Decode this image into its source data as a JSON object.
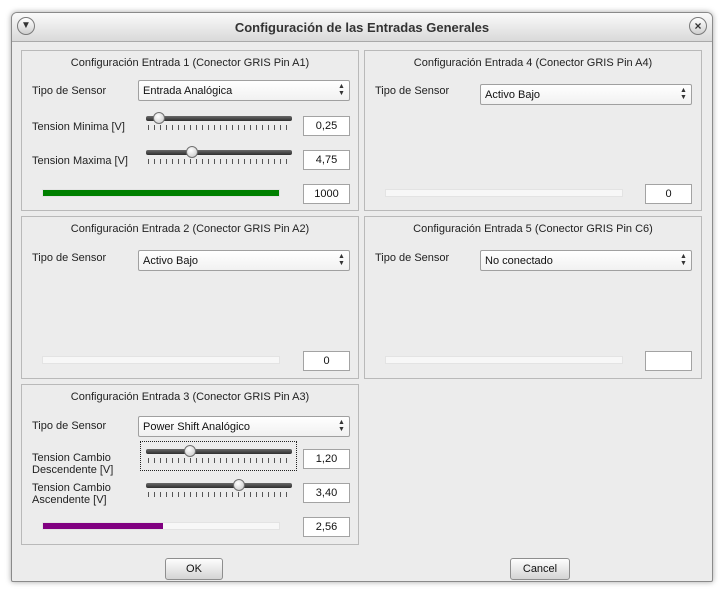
{
  "window": {
    "title": "Configuración de las Entradas Generales",
    "menu_icon": "chevron-down-icon",
    "close_icon": "close-icon"
  },
  "colors": {
    "green_bar": "#008000",
    "purple_bar": "#800080"
  },
  "entrada1": {
    "title": "Configuración Entrada 1 (Conector GRIS Pin A1)",
    "sensor_label": "Tipo de Sensor",
    "sensor_value": "Entrada Analógica",
    "min_label": "Tension Minima [V]",
    "min_value": "0,25",
    "min_level": 0.05,
    "max_label": "Tension Maxima [V]",
    "max_value": "4,75",
    "max_level": 0.3,
    "bar_value": "1000",
    "bar_level": 1.0
  },
  "entrada2": {
    "title": "Configuración Entrada 2 (Conector GRIS Pin A2)",
    "sensor_label": "Tipo de Sensor",
    "sensor_value": "Activo Bajo",
    "bar_value": "0",
    "bar_level": 0
  },
  "entrada3": {
    "title": "Configuración Entrada 3 (Conector GRIS Pin A3)",
    "sensor_label": "Tipo de Sensor",
    "sensor_value": "Power Shift Analógico",
    "down_label_1": "Tension Cambio",
    "down_label_2": "Descendente [V]",
    "down_value": "1,20",
    "down_level": 0.28,
    "up_label_1": "Tension Cambio",
    "up_label_2": "Ascendente [V]",
    "up_value": "3,40",
    "up_level": 0.65,
    "bar_value": "2,56",
    "bar_level": 0.51
  },
  "entrada4": {
    "title": "Configuración Entrada 4 (Conector GRIS Pin A4)",
    "sensor_label": "Tipo de Sensor",
    "sensor_value": "Activo Bajo",
    "bar_value": "0",
    "bar_level": 0
  },
  "entrada5": {
    "title": "Configuración Entrada 5 (Conector GRIS Pin C6)",
    "sensor_label": "Tipo de Sensor",
    "sensor_value": "No conectado",
    "bar_value": "",
    "bar_level": 0
  },
  "buttons": {
    "ok": "OK",
    "cancel": "Cancel"
  }
}
